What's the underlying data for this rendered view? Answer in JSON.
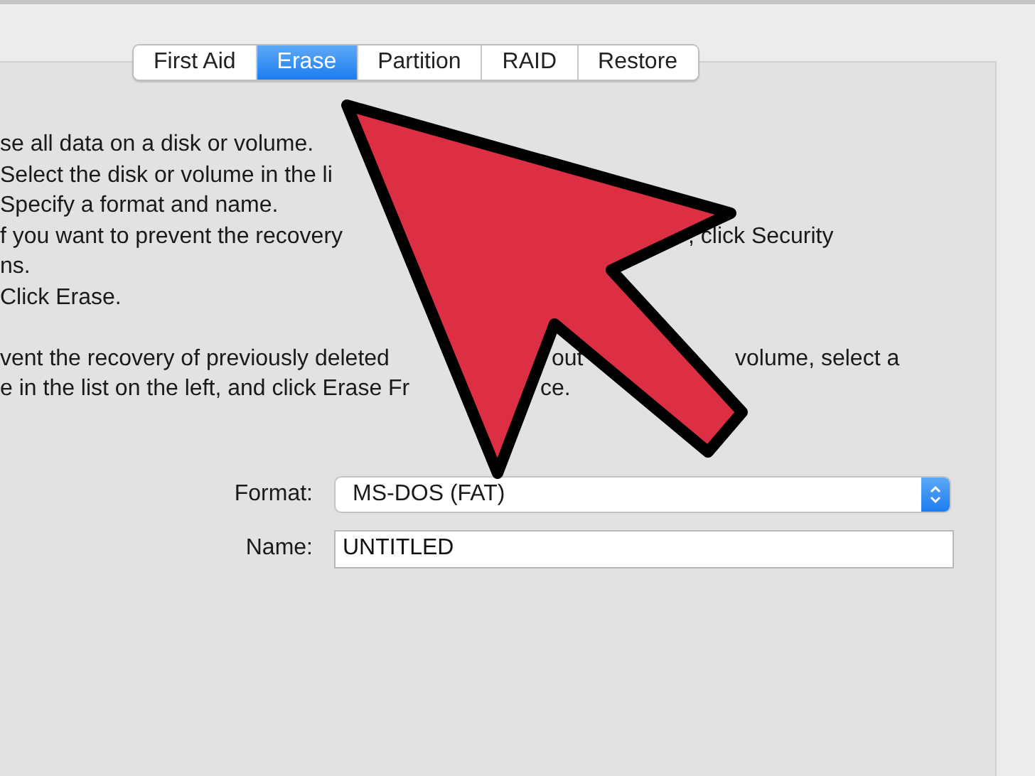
{
  "tabs": [
    {
      "label": "First Aid",
      "selected": false
    },
    {
      "label": "Erase",
      "selected": true
    },
    {
      "label": "Partition",
      "selected": false
    },
    {
      "label": "RAID",
      "selected": false
    },
    {
      "label": "Restore",
      "selected": false
    }
  ],
  "paragraphs": [
    {
      "lines": [
        {
          "segments": [
            "se all data on a disk or volume."
          ]
        },
        {
          "segments": [
            "Select the disk or volume in the li"
          ]
        },
        {
          "segments": [
            "Specify a format and name."
          ]
        },
        {
          "segments": [
            "f you want to prevent the recovery",
            ", click Security"
          ]
        },
        {
          "segments": [
            "ns."
          ]
        },
        {
          "segments": [
            "Click Erase."
          ]
        }
      ]
    },
    {
      "lines": [
        {
          "segments": [
            "vent the recovery of previously deleted",
            "out",
            "volume, select a"
          ]
        },
        {
          "segments": [
            "e in the list on the left, and click Erase Fr",
            "ce."
          ]
        }
      ]
    }
  ],
  "fields": [
    {
      "kind": "select",
      "label": "Format:",
      "value": "MS-DOS (FAT)"
    },
    {
      "kind": "text",
      "label": "Name:",
      "value": "UNTITLED"
    }
  ]
}
